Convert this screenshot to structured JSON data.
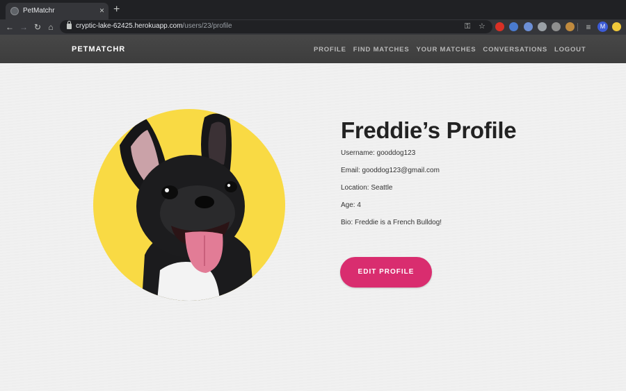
{
  "browser": {
    "tab_title": "PetMatchr",
    "tab_close": "×",
    "new_tab": "+",
    "url_host": "cryptic-lake-62425.herokuapp.com",
    "url_path": "/users/23/profile",
    "avatar_letter": "M",
    "extension_colors": [
      "#d93025",
      "#4a7bd0",
      "#6c8fd6",
      "#9aa0a6",
      "#8f8f8f",
      "#c08a3e"
    ]
  },
  "navbar": {
    "brand": "PETMATCHR",
    "links": [
      "PROFILE",
      "FIND MATCHES",
      "YOUR MATCHES",
      "CONVERSATIONS",
      "LOGOUT"
    ]
  },
  "profile": {
    "title": "Freddie’s Profile",
    "username": "Username: gooddog123",
    "email": "Email: gooddog123@gmail.com",
    "location": "Location: Seattle",
    "age": "Age: 4",
    "bio": "Bio: Freddie is a French Bulldog!",
    "edit_button": "EDIT PROFILE",
    "photo_bg_color": "#f9da44"
  }
}
